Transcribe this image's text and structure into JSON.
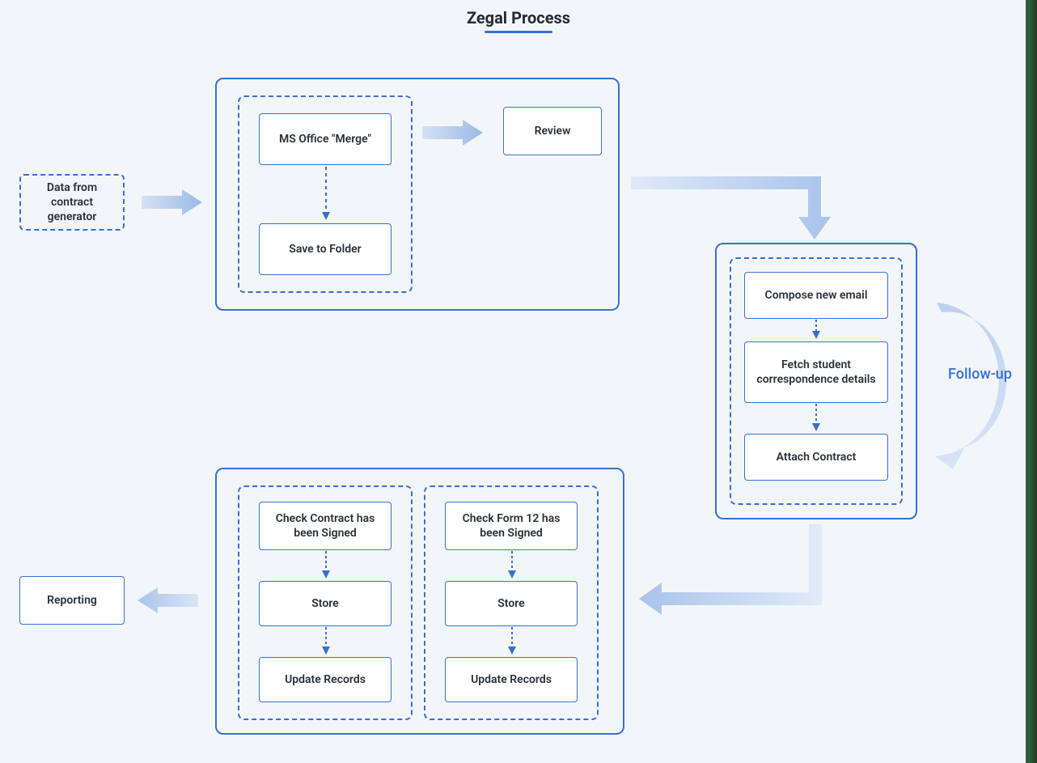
{
  "title": "Zegal Process",
  "left": {
    "data_input": "Data from contract generator",
    "reporting": "Reporting"
  },
  "stage1": {
    "ms_office_merge": "MS Office \"Merge\"",
    "save_to_folder": "Save to Folder",
    "review": "Review"
  },
  "stage2": {
    "compose_email": "Compose new email",
    "fetch_details": "Fetch student correspondence details",
    "attach_contract": "Attach Contract",
    "followup": "Follow-up"
  },
  "stage3": {
    "col1": {
      "check": "Check Contract has been Signed",
      "store": "Store",
      "update": "Update Records"
    },
    "col2": {
      "check": "Check Form 12 has been Signed",
      "store": "Store",
      "update": "Update Records"
    }
  }
}
